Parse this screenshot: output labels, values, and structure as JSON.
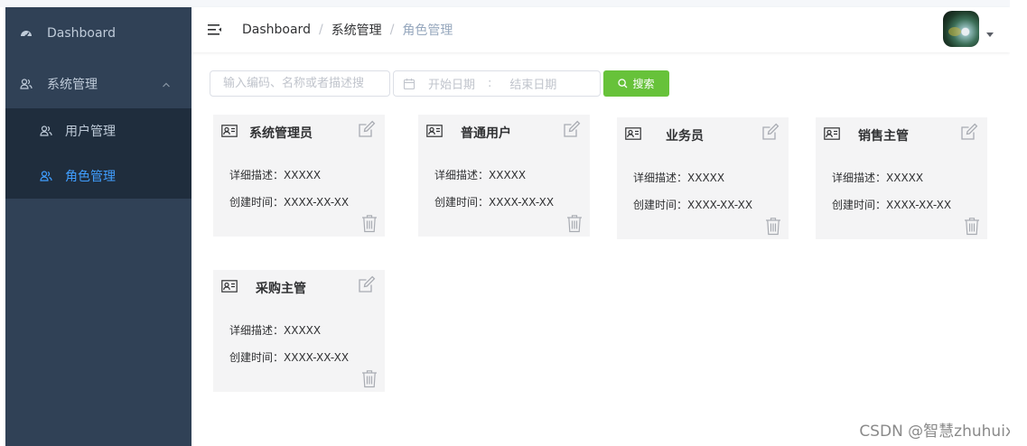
{
  "sidebar": {
    "dashboard_label": "Dashboard",
    "system_label": "系统管理",
    "items": [
      {
        "label": "用户管理",
        "active": false
      },
      {
        "label": "角色管理",
        "active": true
      }
    ],
    "active_color": "#409eff",
    "bg_color": "#304156"
  },
  "header": {
    "breadcrumb": [
      "Dashboard",
      "系统管理",
      "角色管理"
    ],
    "breadcrumb_separator": "/"
  },
  "search": {
    "placeholder": "输入编码、名称或者描述搜",
    "date_start_placeholder": "开始日期",
    "date_separator": ":",
    "date_end_placeholder": "结束日期",
    "button_label": "搜索",
    "button_color": "#67c23a"
  },
  "roles": [
    {
      "name": "系统管理员",
      "desc_label": "详细描述：",
      "desc_value": "XXXXX",
      "time_label": "创建时间：",
      "time_value": "XXXX-XX-XX"
    },
    {
      "name": "普通用户",
      "desc_label": "详细描述：",
      "desc_value": "XXXXX",
      "time_label": "创建时间：",
      "time_value": "XXXX-XX-XX"
    },
    {
      "name": "业务员",
      "desc_label": "详细描述：",
      "desc_value": "XXXXX",
      "time_label": "创建时间：",
      "time_value": "XXXX-XX-XX"
    },
    {
      "name": "销售主管",
      "desc_label": "详细描述：",
      "desc_value": "XXXXX",
      "time_label": "创建时间：",
      "time_value": "XXXX-XX-XX"
    },
    {
      "name": "采购主管",
      "desc_label": "详细描述：",
      "desc_value": "XXXXX",
      "time_label": "创建时间：",
      "time_value": "XXXX-XX-XX"
    }
  ],
  "icons": {
    "dashboard": "dashboard-icon",
    "system": "user-group-icon",
    "role_card": "id-card-icon",
    "edit": "edit-icon",
    "delete": "trash-icon",
    "calendar": "calendar-icon",
    "search": "search-icon",
    "menu_toggle": "hamburger-icon"
  },
  "watermark": "CSDN @智慧zhuhuix"
}
